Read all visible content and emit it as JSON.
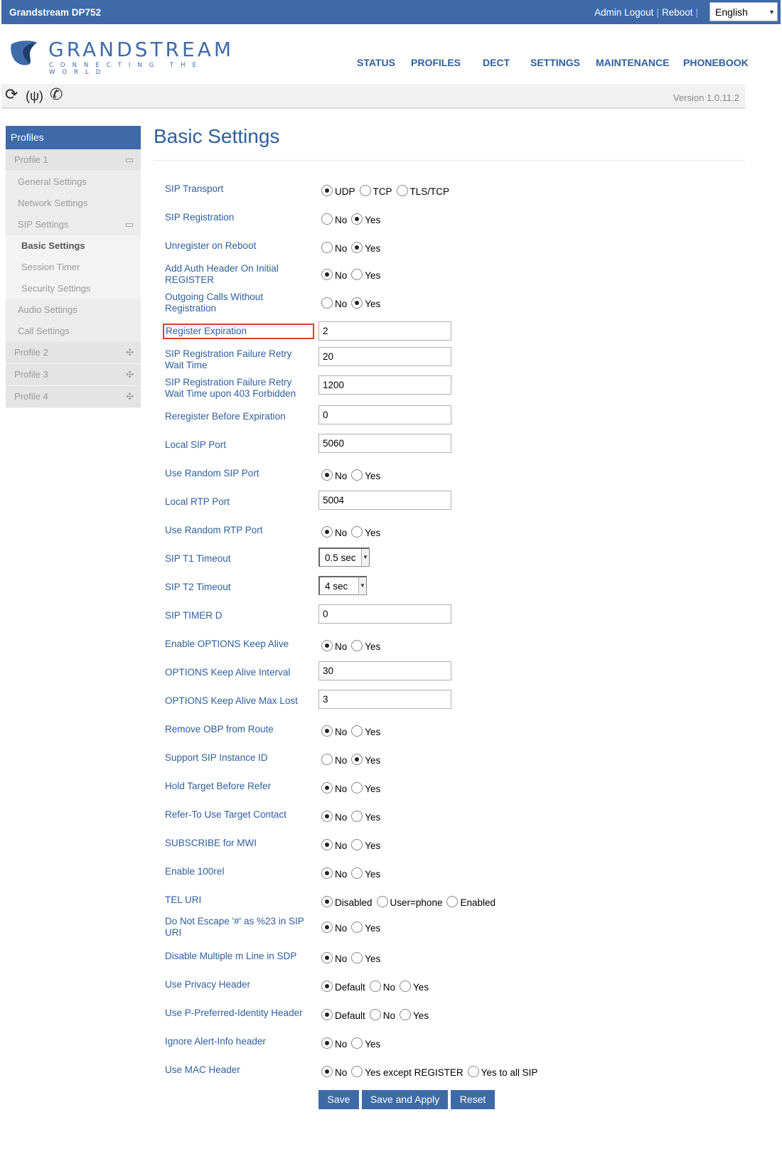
{
  "header": {
    "product": "Grandstream DP752",
    "admin_logout": "Admin Logout",
    "reboot": "Reboot",
    "language": "English"
  },
  "logo": {
    "word": "GRANDSTREAM",
    "tagline": "CONNECTING THE WORLD"
  },
  "nav": {
    "status": "STATUS",
    "profiles": "PROFILES",
    "dect": "DECT",
    "settings": "SETTINGS",
    "maintenance": "MAINTENANCE",
    "phonebook": "PHONEBOOK"
  },
  "toolbar": {
    "icons": [
      "refresh-icon",
      "antenna-icon",
      "phone-icon"
    ],
    "version": "Version 1.0.11.2"
  },
  "sidebar": {
    "head": "Profiles",
    "profile1": "Profile 1",
    "general": "General Settings",
    "network": "Network Settings",
    "sip": "SIP Settings",
    "basic": "Basic Settings",
    "session": "Session Timer",
    "security": "Security Settings",
    "audio": "Audio Settings",
    "call": "Call Settings",
    "profile2": "Profile 2",
    "profile3": "Profile 3",
    "profile4": "Profile 4"
  },
  "page": {
    "title": "Basic Settings"
  },
  "form": {
    "sip_transport": {
      "label": "SIP Transport",
      "options": [
        "UDP",
        "TCP",
        "TLS/TCP"
      ],
      "selected": "UDP"
    },
    "sip_registration": {
      "label": "SIP Registration",
      "options": [
        "No",
        "Yes"
      ],
      "selected": "Yes"
    },
    "unregister_on_reboot": {
      "label": "Unregister on Reboot",
      "options": [
        "No",
        "Yes"
      ],
      "selected": "Yes"
    },
    "add_auth_header": {
      "label": "Add Auth Header On Initial REGISTER",
      "options": [
        "No",
        "Yes"
      ],
      "selected": "No"
    },
    "outgoing_without_reg": {
      "label": "Outgoing Calls Without Registration",
      "options": [
        "No",
        "Yes"
      ],
      "selected": "Yes"
    },
    "register_expiration": {
      "label": "Register Expiration",
      "value": "2"
    },
    "reg_failure_retry": {
      "label": "SIP Registration Failure Retry Wait Time",
      "value": "20"
    },
    "reg_failure_retry_403": {
      "label": "SIP Registration Failure Retry Wait Time upon 403 Forbidden",
      "value": "1200"
    },
    "reregister_before_exp": {
      "label": "Reregister Before Expiration",
      "value": "0"
    },
    "local_sip_port": {
      "label": "Local SIP Port",
      "value": "5060"
    },
    "random_sip_port": {
      "label": "Use Random SIP Port",
      "options": [
        "No",
        "Yes"
      ],
      "selected": "No"
    },
    "local_rtp_port": {
      "label": "Local RTP Port",
      "value": "5004"
    },
    "random_rtp_port": {
      "label": "Use Random RTP Port",
      "options": [
        "No",
        "Yes"
      ],
      "selected": "No"
    },
    "sip_t1_timeout": {
      "label": "SIP T1 Timeout",
      "value": "0.5 sec"
    },
    "sip_t2_timeout": {
      "label": "SIP T2 Timeout",
      "value": "4 sec"
    },
    "sip_timer_d": {
      "label": "SIP TIMER D",
      "value": "0"
    },
    "options_keep_alive": {
      "label": "Enable OPTIONS Keep Alive",
      "options": [
        "No",
        "Yes"
      ],
      "selected": "No"
    },
    "options_interval": {
      "label": "OPTIONS Keep Alive Interval",
      "value": "30"
    },
    "options_max_lost": {
      "label": "OPTIONS Keep Alive Max Lost",
      "value": "3"
    },
    "remove_obp": {
      "label": "Remove OBP from Route",
      "options": [
        "No",
        "Yes"
      ],
      "selected": "No"
    },
    "sip_instance_id": {
      "label": "Support SIP Instance ID",
      "options": [
        "No",
        "Yes"
      ],
      "selected": "Yes"
    },
    "hold_target": {
      "label": "Hold Target Before Refer",
      "options": [
        "No",
        "Yes"
      ],
      "selected": "No"
    },
    "refer_to_target": {
      "label": "Refer-To Use Target Contact",
      "options": [
        "No",
        "Yes"
      ],
      "selected": "No"
    },
    "subscribe_mwi": {
      "label": "SUBSCRIBE for MWI",
      "options": [
        "No",
        "Yes"
      ],
      "selected": "No"
    },
    "enable_100rel": {
      "label": "Enable 100rel",
      "options": [
        "No",
        "Yes"
      ],
      "selected": "No"
    },
    "tel_uri": {
      "label": "TEL URI",
      "options": [
        "Disabled",
        "User=phone",
        "Enabled"
      ],
      "selected": "Disabled"
    },
    "no_escape": {
      "label": "Do Not Escape '#' as %23 in SIP URI",
      "options": [
        "No",
        "Yes"
      ],
      "selected": "No"
    },
    "multiple_m_line": {
      "label": "Disable Multiple m Line in SDP",
      "options": [
        "No",
        "Yes"
      ],
      "selected": "No"
    },
    "privacy_header": {
      "label": "Use Privacy Header",
      "options": [
        "Default",
        "No",
        "Yes"
      ],
      "selected": "Default"
    },
    "ppi_header": {
      "label": "Use P-Preferred-Identity Header",
      "options": [
        "Default",
        "No",
        "Yes"
      ],
      "selected": "Default"
    },
    "ignore_alert_info": {
      "label": "Ignore Alert-Info header",
      "options": [
        "No",
        "Yes"
      ],
      "selected": "No"
    },
    "mac_header": {
      "label": "Use MAC Header",
      "options": [
        "No",
        "Yes except REGISTER",
        "Yes to all SIP"
      ],
      "selected": "No"
    }
  },
  "buttons": {
    "save": "Save",
    "save_apply": "Save and Apply",
    "reset": "Reset"
  }
}
